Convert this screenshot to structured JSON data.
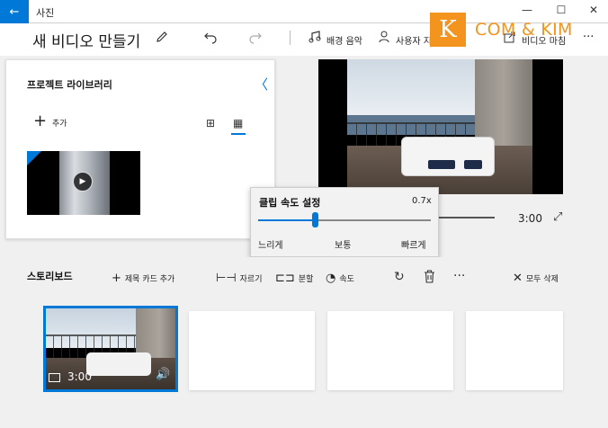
{
  "titlebar": {
    "back_glyph": "←",
    "app_name": "사진",
    "min_glyph": "—",
    "max_glyph": "☐",
    "close_glyph": "✕"
  },
  "toolbar": {
    "project_title": "새 비디오 만들기",
    "edit_icon": "pencil-icon",
    "undo_icon": "undo-icon",
    "redo_icon": "redo-icon",
    "bg_music_label": "배경 음악",
    "custom_audio_label": "사용자 지",
    "finish_label": "비디오 마침",
    "more_glyph": "···"
  },
  "watermark": {
    "letter": "K",
    "text": "COM & KIM",
    "color": "#f3941e"
  },
  "library": {
    "title": "프로젝트 라이브러리",
    "collapse_glyph": "〈",
    "add_label": "추가",
    "grid_small_glyph": "⊞",
    "grid_large_glyph": "▦"
  },
  "preview": {
    "duration": "3:00",
    "expand_glyph": "⤢"
  },
  "speed_popup": {
    "title": "클립 속도 설정",
    "value": "0.7x",
    "level": 0.33,
    "slow_label": "느리게",
    "normal_label": "보통",
    "fast_label": "빠르게"
  },
  "storyboard": {
    "title": "스토리보드",
    "add_title_card": "제목 카드 추가",
    "trim": "자르기",
    "split": "분할",
    "speed": "속도",
    "more_glyph": "···",
    "remove_all": "모두 삭제",
    "clip_duration": "3:00",
    "volume_glyph": "🔊"
  },
  "colors": {
    "accent": "#0078d7",
    "panel_bg": "#f0f0f0"
  }
}
